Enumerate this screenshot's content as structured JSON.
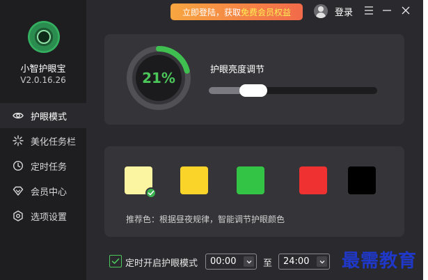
{
  "app": {
    "name": "小智护眼宝",
    "version": "V2.0.16.26"
  },
  "titlebar": {
    "promo_prefix": "立即登陆，获取",
    "promo_highlight": "免费会员权益",
    "login_label": "登录"
  },
  "sidebar": {
    "items": [
      {
        "label": "护眼模式",
        "icon": "eye-icon",
        "active": true
      },
      {
        "label": "美化任务栏",
        "icon": "sparkle-icon",
        "active": false
      },
      {
        "label": "定时任务",
        "icon": "clock-icon",
        "active": false
      },
      {
        "label": "会员中心",
        "icon": "diamond-icon",
        "active": false
      },
      {
        "label": "选项设置",
        "icon": "settings-icon",
        "active": false
      }
    ]
  },
  "brightness": {
    "percent_text": "21%",
    "percent": 21,
    "label": "护眼亮度调节",
    "slider_fraction": 0.21
  },
  "colors": {
    "swatches": [
      {
        "color": "#fbf4a0",
        "selected": true
      },
      {
        "color": "#fbd42a",
        "selected": false
      },
      {
        "color": "#34c445",
        "selected": false
      },
      {
        "color": "#ef3131",
        "selected": false
      },
      {
        "color": "#000000",
        "selected": false
      }
    ],
    "recommend_text": "推荐色：根据昼夜规律，智能调节护眼颜色",
    "accent": "#4bc75a"
  },
  "timer": {
    "checkbox_checked": true,
    "label": "定时开启护眼模式",
    "start": "00:00",
    "to_label": "至",
    "end": "24:00"
  },
  "watermark": "最需教育"
}
